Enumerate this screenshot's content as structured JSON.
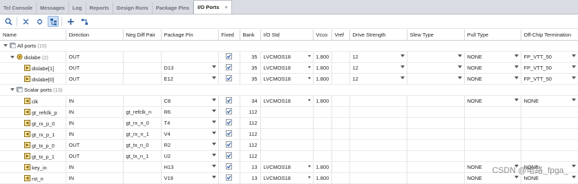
{
  "tabs": [
    {
      "label": "Tcl Console",
      "active": false
    },
    {
      "label": "Messages",
      "active": false
    },
    {
      "label": "Log",
      "active": false
    },
    {
      "label": "Reports",
      "active": false
    },
    {
      "label": "Design Runs",
      "active": false
    },
    {
      "label": "Package Pins",
      "active": false
    },
    {
      "label": "I/O Ports",
      "active": true
    }
  ],
  "close_glyph": "×",
  "toolbar": [
    "search-icon",
    "collapse-all-icon",
    "expand-all-icon",
    "group-by-interface-icon",
    "add-icon",
    "auto-assign-icon"
  ],
  "columns": [
    "Name",
    "Direction",
    "Neg Diff Pair",
    "Package Pin",
    "Fixed",
    "Bank",
    "I/O Std",
    "Vcco",
    "Vref",
    "Drive Strength",
    "Slew Type",
    "Pull Type",
    "Off-Chip Termination"
  ],
  "groups": {
    "all_ports": {
      "label": "All ports",
      "count": "(15)"
    },
    "scalar_ports": {
      "label": "Scalar ports",
      "count": "(13)"
    }
  },
  "rows": [
    {
      "kind": "bus",
      "name": "dislabe",
      "count": "(2)",
      "direction": "OUT",
      "neg": "",
      "pin": "",
      "fixed": true,
      "bank": "35",
      "iostd": "LVCMOS18",
      "vcco": "1.800",
      "vref": "",
      "drive": "12",
      "slew": "",
      "pull": "NONE",
      "term": "FP_VTT_50"
    },
    {
      "kind": "bit",
      "name": "dislabe[1]",
      "direction": "OUT",
      "neg": "",
      "pin": "D13",
      "fixed": true,
      "bank": "35",
      "iostd": "LVCMOS18",
      "vcco": "1.800",
      "vref": "",
      "drive": "12",
      "slew": "",
      "pull": "NONE",
      "term": "FP_VTT_50"
    },
    {
      "kind": "bit",
      "name": "dislabe[0]",
      "direction": "OUT",
      "neg": "",
      "pin": "E12",
      "fixed": true,
      "bank": "35",
      "iostd": "LVCMOS18",
      "vcco": "1.800",
      "vref": "",
      "drive": "12",
      "slew": "",
      "pull": "NONE",
      "term": "FP_VTT_50"
    },
    {
      "kind": "scalar-group"
    },
    {
      "kind": "scalar",
      "name": "clk",
      "direction": "IN",
      "neg": "",
      "pin": "C8",
      "fixed": true,
      "bank": "34",
      "iostd": "LVCMOS18",
      "vcco": "1.800",
      "vref": "",
      "drive": "",
      "slew": "",
      "pull": "NONE",
      "term": "NONE"
    },
    {
      "kind": "scalar",
      "name": "gt_refclk_p",
      "direction": "IN",
      "neg": "gt_refclk_n",
      "pin": "R6",
      "fixed": true,
      "bank": "112",
      "iostd": "",
      "vcco": "",
      "vref": "",
      "drive": "",
      "slew": "",
      "pull": "",
      "term": ""
    },
    {
      "kind": "scalar",
      "name": "gt_rx_p_0",
      "direction": "IN",
      "neg": "gt_rx_n_0",
      "pin": "T4",
      "fixed": true,
      "bank": "112",
      "iostd": "",
      "vcco": "",
      "vref": "",
      "drive": "",
      "slew": "",
      "pull": "",
      "term": ""
    },
    {
      "kind": "scalar",
      "name": "gt_rx_p_1",
      "direction": "IN",
      "neg": "gt_rx_n_1",
      "pin": "V4",
      "fixed": true,
      "bank": "112",
      "iostd": "",
      "vcco": "",
      "vref": "",
      "drive": "",
      "slew": "",
      "pull": "",
      "term": ""
    },
    {
      "kind": "scalar",
      "name": "gt_tx_p_0",
      "direction": "OUT",
      "neg": "gt_tx_n_0",
      "pin": "R2",
      "fixed": true,
      "bank": "112",
      "iostd": "",
      "vcco": "",
      "vref": "",
      "drive": "",
      "slew": "",
      "pull": "",
      "term": ""
    },
    {
      "kind": "scalar",
      "name": "gt_tx_p_1",
      "direction": "OUT",
      "neg": "gt_tx_n_1",
      "pin": "U2",
      "fixed": true,
      "bank": "112",
      "iostd": "",
      "vcco": "",
      "vref": "",
      "drive": "",
      "slew": "",
      "pull": "",
      "term": ""
    },
    {
      "kind": "scalar",
      "name": "key_in",
      "direction": "IN",
      "neg": "",
      "pin": "H13",
      "fixed": true,
      "bank": "13",
      "iostd": "LVCMOS18",
      "vcco": "1.800",
      "vref": "",
      "drive": "",
      "slew": "",
      "pull": "NONE",
      "term": "NONE"
    },
    {
      "kind": "scalar",
      "name": "rst_n",
      "direction": "IN",
      "neg": "",
      "pin": "V19",
      "fixed": true,
      "bank": "13",
      "iostd": "LVCMOS18",
      "vcco": "1.800",
      "vref": "",
      "drive": "",
      "slew": "",
      "pull": "NONE",
      "term": "NONE"
    }
  ],
  "watermark": "CSDN @电路_fpga_"
}
